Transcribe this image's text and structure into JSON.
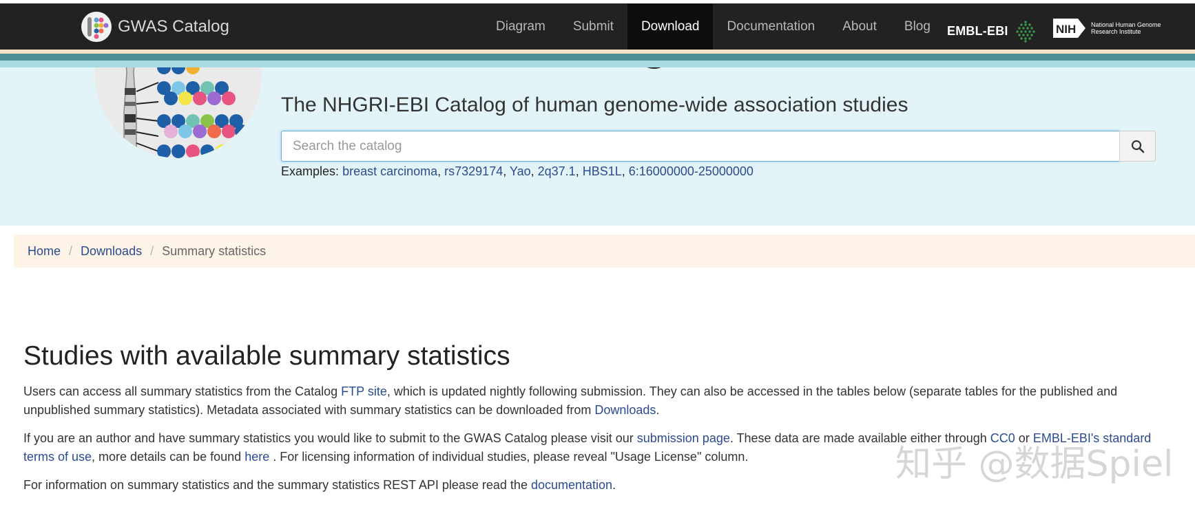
{
  "navbar": {
    "brand": "GWAS Catalog",
    "items": [
      {
        "label": "Diagram"
      },
      {
        "label": "Submit"
      },
      {
        "label": "Download"
      },
      {
        "label": "Documentation"
      },
      {
        "label": "About"
      },
      {
        "label": "Blog"
      }
    ],
    "active_item": "Download",
    "partner1": "EMBL-EBI",
    "partner2_abbr": "NIH",
    "partner2_line1": "National Human Genome",
    "partner2_line2": "Research Institute"
  },
  "hero": {
    "tagline": "The NHGRI-EBI Catalog of human genome-wide association studies",
    "search_placeholder": "Search the catalog",
    "search_icon": "search-icon",
    "examples_label": "Examples:",
    "examples": [
      "breast carcinoma",
      "rs7329174",
      "Yao",
      "2q37.1",
      "HBS1L",
      "6:16000000-25000000"
    ]
  },
  "breadcrumb": {
    "home": "Home",
    "downloads": "Downloads",
    "current": "Summary statistics"
  },
  "content": {
    "title": "Studies with available summary statistics",
    "p1_a": "Users can access all summary statistics from the Catalog ",
    "p1_link1": "FTP site",
    "p1_b": ", which is updated nightly following submission. They can also be accessed in the tables below (separate tables for the published and",
    "p1_c": "unpublished summary statistics). Metadata associated with summary statistics can be downloaded from ",
    "p1_link2": "Downloads",
    "p1_d": ".",
    "p2_a": "If you are an author and have summary statistics you would like to submit to the GWAS Catalog please visit our ",
    "p2_link1": "submission page",
    "p2_b": ". These data are made available either through ",
    "p2_link2": "CC0",
    "p2_c": " or ",
    "p2_link3": "EMBL-EBI's standard",
    "p2_link4": "terms of use",
    "p2_d": ", more details can be found ",
    "p2_link5": "here",
    "p2_e": " . For licensing information of individual studies, please reveal \"Usage License\" column.",
    "p3_a": "For information on summary statistics and the summary statistics REST API please read the ",
    "p3_link": "documentation",
    "p3_b": "."
  },
  "watermark": "知乎 @数据Spiel",
  "colors": {
    "navbar": "#222222",
    "hero_bg": "#e3f4f8",
    "breadcrumb_bg": "#fdf4e7",
    "link": "#2b4b8f"
  }
}
